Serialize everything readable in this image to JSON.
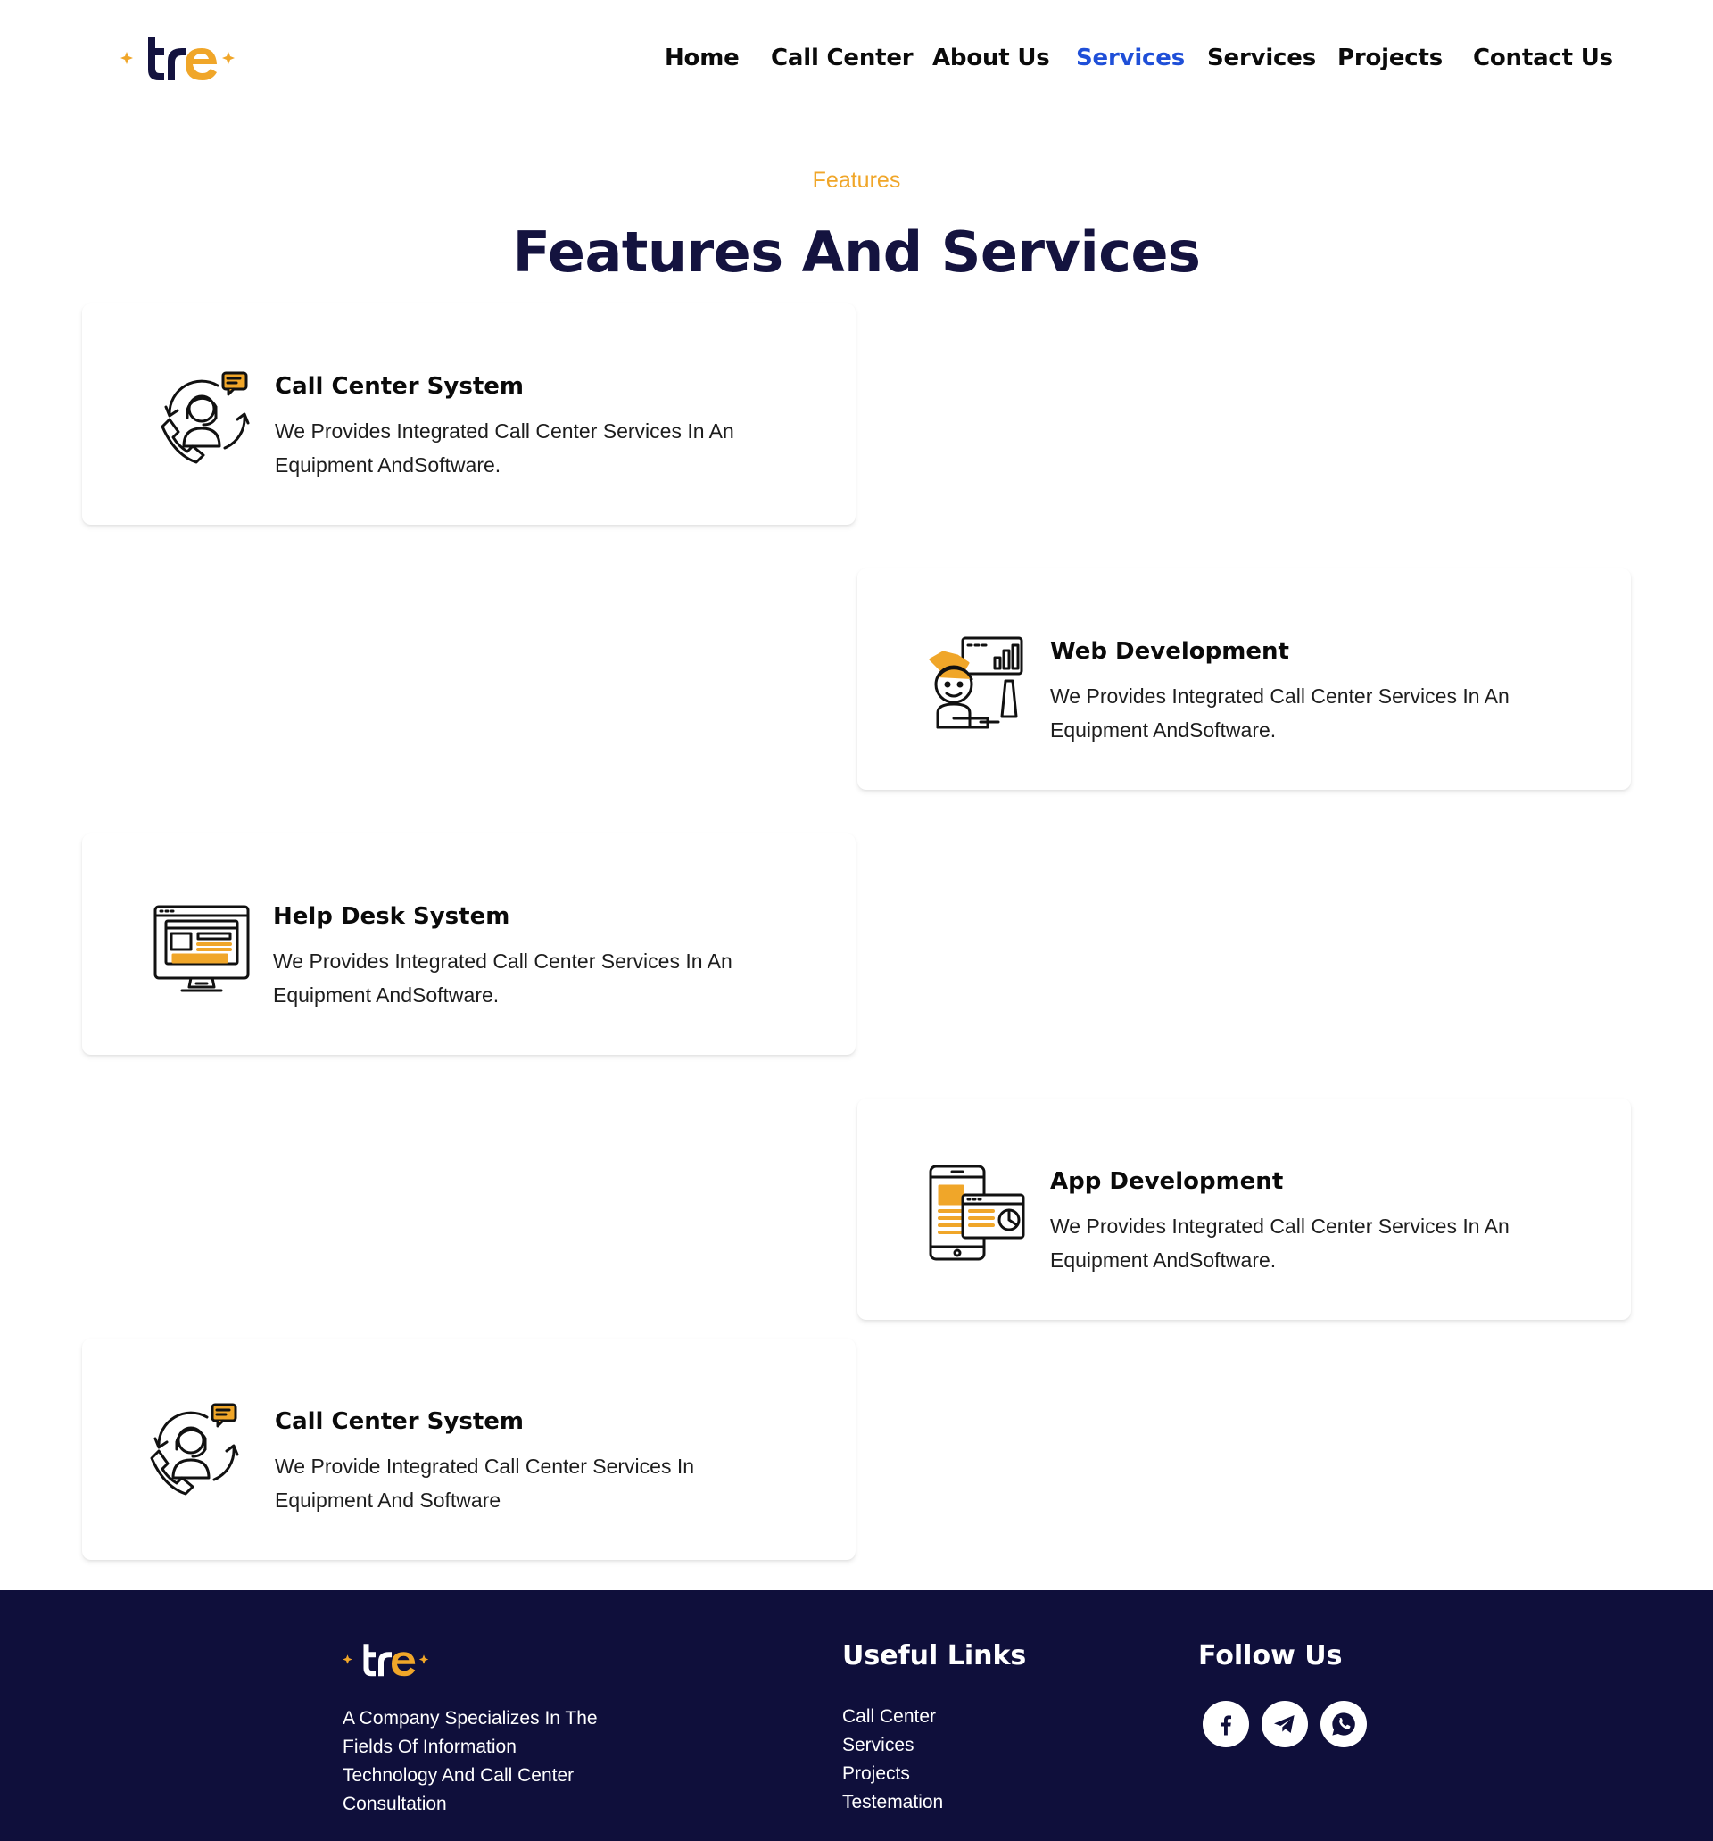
{
  "brand": {
    "logo_text": "tre",
    "accent_color": "#f0a629",
    "navy_color": "#14133f"
  },
  "nav": {
    "items": [
      {
        "label": "Home",
        "active": false
      },
      {
        "label": "Call Center",
        "active": false
      },
      {
        "label": "About Us",
        "active": false
      },
      {
        "label": "Services",
        "active": true
      },
      {
        "label": "Services",
        "active": false
      },
      {
        "label": "Projects",
        "active": false
      },
      {
        "label": "Contact Us",
        "active": false
      }
    ],
    "active_color": "#1f4fd8"
  },
  "section": {
    "eyebrow": "Features",
    "title": "Features And Services"
  },
  "cards": [
    {
      "icon": "call-center-agent-icon",
      "title": "Call Center System",
      "desc": "We Provides Integrated Call Center Services In An Equipment AndSoftware."
    },
    {
      "icon": "web-developer-icon",
      "title": "Web Development",
      "desc": "We Provides Integrated Call Center Services In An Equipment AndSoftware."
    },
    {
      "icon": "help-desk-monitor-icon",
      "title": "Help Desk System",
      "desc": "We Provides Integrated Call Center Services In An Equipment AndSoftware."
    },
    {
      "icon": "mobile-app-icon",
      "title": "App Development",
      "desc": "We Provides Integrated Call Center Services In An Equipment AndSoftware."
    },
    {
      "icon": "call-center-agent-icon",
      "title": "Call Center System",
      "desc": "We Provide Integrated Call Center Services In Equipment And Software"
    }
  ],
  "footer": {
    "about": "A Company Specializes In The Fields Of Information Technology And Call Center Consultation",
    "useful_links_title": "Useful Links",
    "links": [
      "Call Center",
      "Services",
      "Projects",
      "Testemation"
    ],
    "follow_title": "Follow Us",
    "social": [
      "facebook-icon",
      "telegram-icon",
      "whatsapp-icon"
    ]
  }
}
